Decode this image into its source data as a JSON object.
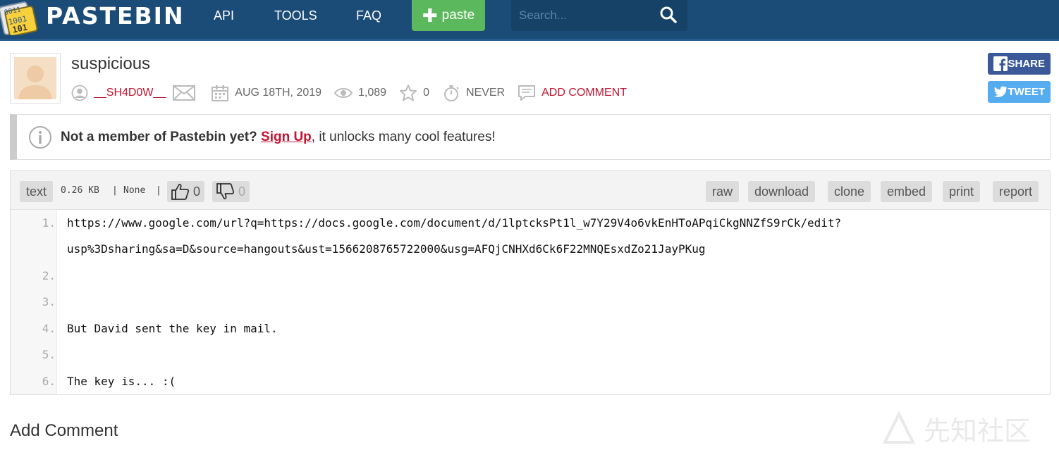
{
  "header": {
    "logo_text": "PASTEBIN",
    "logo_icon_digits": [
      "0011",
      "1001",
      "101"
    ],
    "nav": [
      "API",
      "TOOLS",
      "FAQ"
    ],
    "paste_label": "paste",
    "search_placeholder": "Search..."
  },
  "paste": {
    "title": "suspicious",
    "author": "__SH4D0W__",
    "date": "AUG 18TH, 2019",
    "views": "1,089",
    "stars": "0",
    "expiry": "NEVER",
    "add_comment": "ADD COMMENT"
  },
  "share": {
    "facebook": "SHARE",
    "twitter": "TWEET"
  },
  "notice": {
    "bold": "Not a member of Pastebin yet?",
    "link": "Sign Up",
    "rest": ", it unlocks many cool features!"
  },
  "toolbar": {
    "syntax": "text",
    "size": "0.26 KB",
    "category": "None",
    "likes": "0",
    "dislikes": "0",
    "actions": [
      "raw",
      "download",
      "clone",
      "embed",
      "print",
      "report"
    ]
  },
  "code": {
    "lines": [
      {
        "num": "1.",
        "text": "https://www.google.com/url?q=https://docs.google.com/document/d/1lptcksPt1l_w7Y29V4o6vkEnHToAPqiCkgNNZfS9rCk/edit?"
      },
      {
        "num": "",
        "text": "usp%3Dsharing&sa=D&source=hangouts&ust=1566208765722000&usg=AFQjCNHXd6Ck6F22MNQEsxdZo21JayPKug"
      },
      {
        "num": "2.",
        "text": ""
      },
      {
        "num": "3.",
        "text": ""
      },
      {
        "num": "4.",
        "text": "But David sent the key in mail."
      },
      {
        "num": "5.",
        "text": ""
      },
      {
        "num": "6.",
        "text": "The key is... :("
      }
    ]
  },
  "add_comment_heading": "Add Comment",
  "watermark_text": "先知社区",
  "colors": {
    "header": "#1b4b77",
    "accent_red": "#c41230",
    "paste_green": "#5cb85c",
    "facebook": "#3b5998",
    "twitter": "#55acee"
  }
}
